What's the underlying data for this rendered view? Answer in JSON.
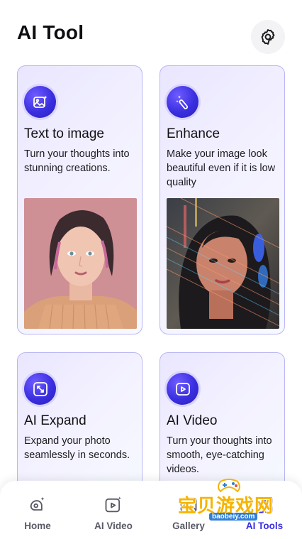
{
  "header": {
    "title": "AI Tool",
    "settings_icon": "gear-icon"
  },
  "cards": [
    {
      "title": "Text to image",
      "description": "Turn your thoughts into stunning creations.",
      "icon": "image-sparkle-icon",
      "image": "portrait-woman-pink-background"
    },
    {
      "title": "Enhance",
      "description": "Make your image look beautiful even if it is low quality",
      "icon": "magic-wand-icon",
      "image": "portrait-woman-neon-lights"
    },
    {
      "title": "AI Expand",
      "description": "Expand your photo seamlessly in seconds.",
      "icon": "expand-arrows-icon"
    },
    {
      "title": "AI Video",
      "description": "Turn your thoughts into smooth, eye-catching videos.",
      "icon": "video-play-icon"
    }
  ],
  "nav": [
    {
      "label": "Home",
      "icon": "home-sparkle-icon",
      "active": false
    },
    {
      "label": "AI Video",
      "icon": "video-play-icon",
      "active": false
    },
    {
      "label": "Gallery",
      "icon": "gallery-icon",
      "active": false
    },
    {
      "label": "AI Tools",
      "icon": "tools-icon",
      "active": true
    }
  ],
  "watermark": {
    "text": "宝贝游戏网",
    "url": "baobeiy.com"
  },
  "colors": {
    "accent": "#3a2fe0",
    "card_border": "#b9b6f5",
    "card_bg": "#efecff"
  }
}
